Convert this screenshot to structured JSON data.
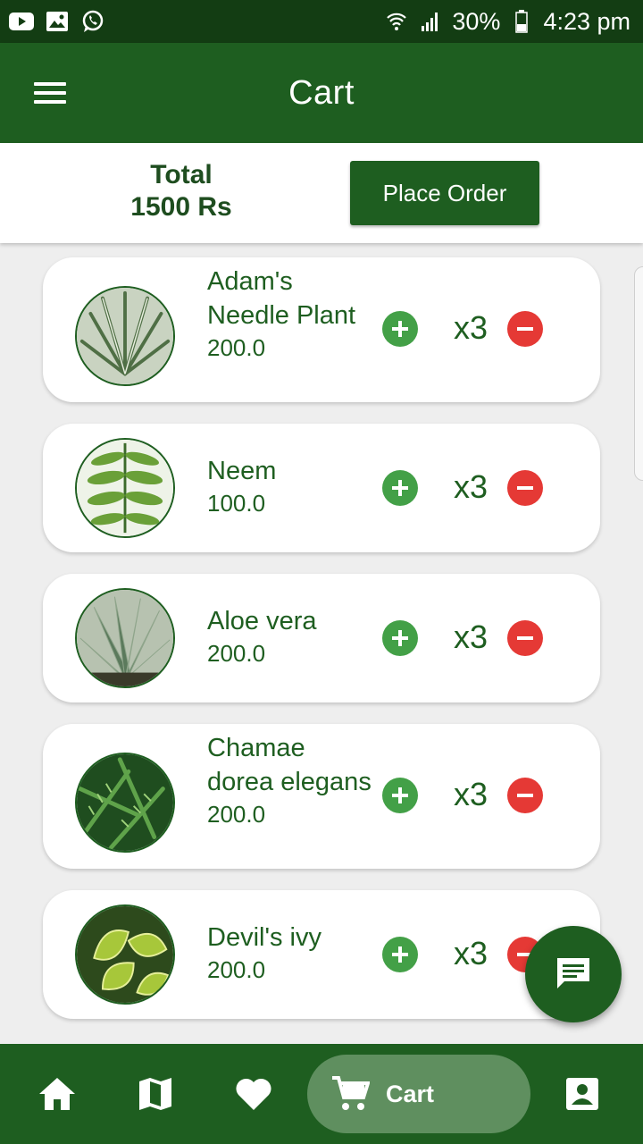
{
  "status_bar": {
    "battery": "30%",
    "time": "4:23 pm"
  },
  "app_bar": {
    "title": "Cart"
  },
  "total": {
    "label": "Total",
    "amount": "1500 Rs"
  },
  "place_order_label": "Place Order",
  "cart_items": [
    {
      "name": "Adam's Needle Plant",
      "price": "200.0",
      "qty": "x3"
    },
    {
      "name": "Neem",
      "price": "100.0",
      "qty": "x3"
    },
    {
      "name": "Aloe vera",
      "price": "200.0",
      "qty": "x3"
    },
    {
      "name": "Chamae dorea elegans",
      "price": "200.0",
      "qty": "x3"
    },
    {
      "name": "Devil's ivy",
      "price": "200.0",
      "qty": "x3"
    }
  ],
  "bottom_nav": {
    "active_label": "Cart"
  },
  "colors": {
    "primary": "#1e5e20",
    "status_bar": "#133d13",
    "add": "#43a047",
    "remove": "#e53935",
    "active_nav": "#5f8f5f"
  }
}
